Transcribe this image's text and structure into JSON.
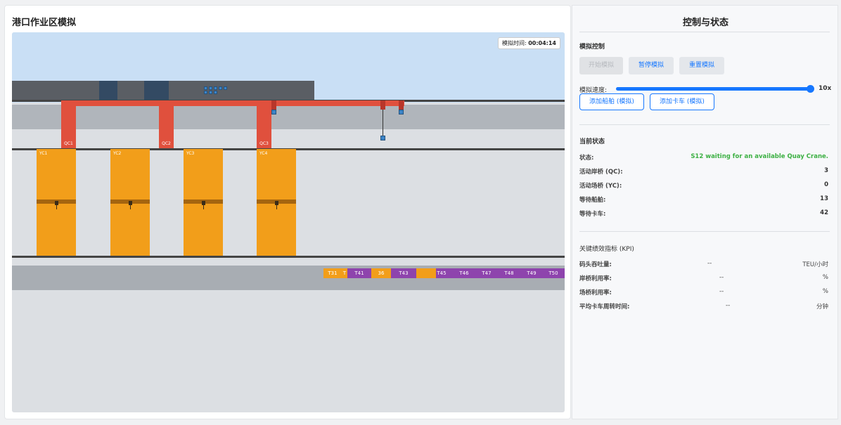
{
  "left": {
    "title": "港口作业区模拟",
    "time_label": "模拟时间:",
    "time_value": "00:04:14",
    "quay_cranes": [
      "QC1",
      "QC2",
      "QC3"
    ],
    "yard_cranes": [
      "YC1",
      "YC2",
      "YC3",
      "YC4"
    ],
    "trucks": [
      "T31",
      "T",
      "T41",
      "36",
      "T43",
      "",
      "T45",
      "T46",
      "T47",
      "T48",
      "T49",
      "T50"
    ]
  },
  "colors": {
    "quay_crane": "#e0503d",
    "yard_crane": "#f29e1a",
    "truck_orange": "#f29e1a",
    "truck_purple": "#8e44ad",
    "container": "#3b84c8",
    "accent": "#1677ff",
    "status_green": "#3cb043"
  },
  "right": {
    "title": "控制与状态",
    "sim_control_title": "模拟控制",
    "start_label": "开始模拟",
    "pause_label": "暂停模拟",
    "reset_label": "重置模拟",
    "speed_label": "模拟速度:",
    "speed_value": "10x",
    "speed_level": 1.0,
    "add_ship_label": "添加船舶 (模拟)",
    "add_truck_label": "添加卡车 (模拟)",
    "status_title": "当前状态",
    "status": [
      {
        "label": "状态:",
        "value": "S12 waiting for an available Quay Crane."
      },
      {
        "label": "活动岸桥 (QC):",
        "value": "3"
      },
      {
        "label": "活动场桥 (YC):",
        "value": "0"
      },
      {
        "label": "等待船舶:",
        "value": "13"
      },
      {
        "label": "等待卡车:",
        "value": "42"
      }
    ],
    "kpi_title": "关键绩效指标 (KPI)",
    "kpis": [
      {
        "label": "码头吞吐量:",
        "value": "--",
        "unit": "TEU/小时"
      },
      {
        "label": "岸桥利用率:",
        "value": "--",
        "unit": "%"
      },
      {
        "label": "场桥利用率:",
        "value": "--",
        "unit": "%"
      },
      {
        "label": "平均卡车周转时间:",
        "value": "--",
        "unit": "分钟"
      }
    ]
  }
}
